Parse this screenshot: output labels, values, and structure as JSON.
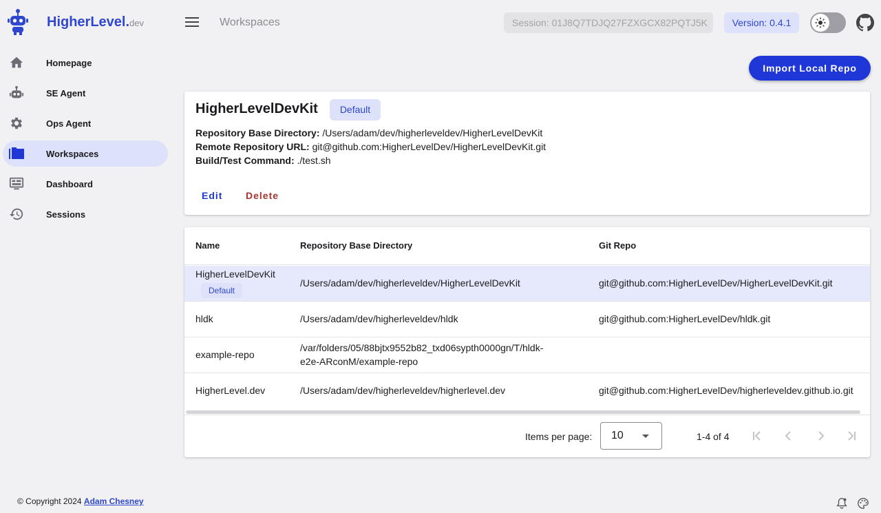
{
  "brand": {
    "name": "HigherLevel.",
    "suffix": "dev"
  },
  "nav": {
    "items": [
      {
        "label": "Homepage",
        "icon": "home-icon"
      },
      {
        "label": "SE Agent",
        "icon": "robot-icon"
      },
      {
        "label": "Ops Agent",
        "icon": "gear-icon"
      },
      {
        "label": "Workspaces",
        "icon": "folder-icon",
        "active": true
      },
      {
        "label": "Dashboard",
        "icon": "monitor-icon"
      },
      {
        "label": "Sessions",
        "icon": "history-icon"
      }
    ]
  },
  "header": {
    "breadcrumb": "Workspaces",
    "session": "Session: 01J8Q7TDJQ27FZXGCX82PQTJ5K",
    "version": "Version: 0.4.1"
  },
  "actions": {
    "import_label": "Import Local Repo"
  },
  "detail": {
    "title": "HigherLevelDevKit",
    "badge": "Default",
    "fields": [
      {
        "label": "Repository Base Directory:",
        "value": "/Users/adam/dev/higherleveldev/HigherLevelDevKit"
      },
      {
        "label": "Remote Repository URL:",
        "value": "git@github.com:HigherLevelDev/HigherLevelDevKit.git"
      },
      {
        "label": "Build/Test Command:",
        "value": "./test.sh"
      }
    ],
    "edit_label": "Edit",
    "delete_label": "Delete"
  },
  "table": {
    "columns": [
      "Name",
      "Repository Base Directory",
      "Git Repo"
    ],
    "rows": [
      {
        "name": "HigherLevelDevKit",
        "badge": "Default",
        "dir": "/Users/adam/dev/higherleveldev/HigherLevelDevKit",
        "dir2": "",
        "git": "git@github.com:HigherLevelDev/HigherLevelDevKit.git",
        "selected": true
      },
      {
        "name": "hldk",
        "badge": "",
        "dir": "/Users/adam/dev/higherleveldev/hldk",
        "dir2": "",
        "git": "git@github.com:HigherLevelDev/hldk.git"
      },
      {
        "name": "example-repo",
        "badge": "",
        "dir": "/var/folders/05/88bjtx9552b82_txd06sypth0000gn/T/hldk-",
        "dir2": "e2e-ARconM/example-repo",
        "git": ""
      },
      {
        "name": "HigherLevel.dev",
        "badge": "",
        "dir": "/Users/adam/dev/higherleveldev/higherlevel.dev",
        "dir2": "",
        "git": "git@github.com:HigherLevelDev/higherleveldev.github.io.git"
      }
    ]
  },
  "pagination": {
    "items_per_page_label": "Items per page:",
    "items_per_page": "10",
    "range": "1-4 of 4"
  },
  "footer": {
    "copyright": "© Copyright 2024",
    "author": "Adam Chesney"
  },
  "colors": {
    "accent": "#1f37d6",
    "danger": "#a8322c",
    "selected_row": "#e6e9fb"
  }
}
